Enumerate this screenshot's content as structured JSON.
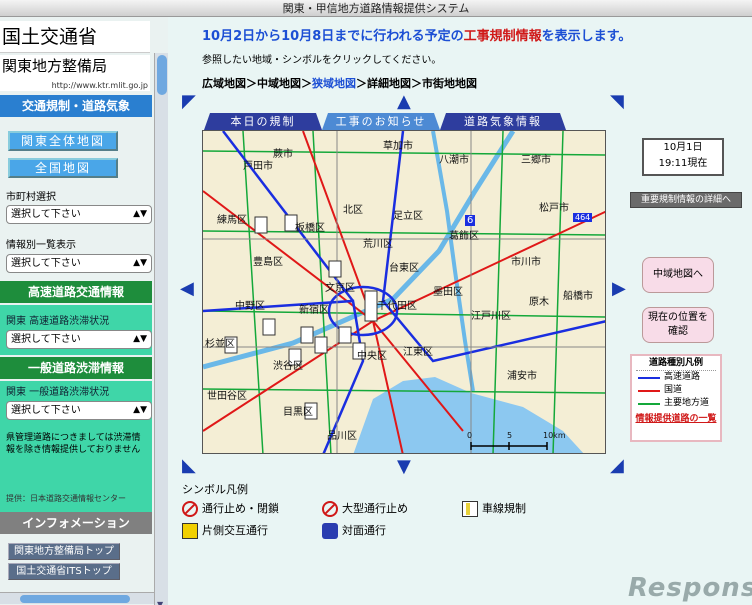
{
  "window": {
    "title": "関東・甲信地方道路情報提供システム"
  },
  "sidebar": {
    "logo_top": "国土交通省",
    "logo_bottom": "関東地方整備局",
    "logo_url": "http://www.ktr.mlit.go.jp",
    "band_traffic": "交通規制・道路気象",
    "btn_kanto": "関東全体地図",
    "btn_all": "全国地図",
    "city_label": "市町村選択",
    "city_select": "選択して下さい",
    "info_label": "情報別一覧表示",
    "info_select": "選択して下さい",
    "band_expressway": "高速道路交通情報",
    "expressway_label": "関東 高速道路渋滞状況",
    "expressway_select": "選択して下さい",
    "band_general": "一般道路渋滞情報",
    "general_label": "関東 一般道路渋滞状況",
    "general_select": "選択して下さい",
    "note": "県管理道路につきましては渋滞情報を除き情報提供しておりません",
    "provider": "提供：日本道路交通情報センター",
    "band_info": "インフォメーション",
    "link_1": "関東地方整備局トップ",
    "link_2": "国土交通省ITSトップ"
  },
  "main": {
    "headline_pre": "10月2日から10月8日までに行われる予定の",
    "headline_highlight": "工事規制情報",
    "headline_post": "を表示します。",
    "subtext": "参照したい地域・シンボルをクリックしてください。",
    "crumbs": [
      "広域地図",
      "中域地図",
      "狭域地図",
      "詳細地図",
      "市街地地図"
    ],
    "crumb_sep": "＞",
    "crumb_current_index": 2,
    "tabs": [
      "本日の規制",
      "工事のお知らせ",
      "道路気象情報"
    ],
    "active_tab": 1,
    "date_line1": "10月1日",
    "date_line2": "19:11現在",
    "detail_button": "重要規制情報の詳細へ",
    "btn_mid_map": "中域地図へ",
    "btn_location": "現在の位置を確認",
    "road_legend": {
      "title": "道路種別凡例",
      "items": [
        {
          "label": "高速道路",
          "color": "#1a2ee0"
        },
        {
          "label": "国道",
          "color": "#e01818"
        },
        {
          "label": "主要地方道",
          "color": "#14a83a"
        }
      ],
      "link": "情報提供道路の一覧"
    },
    "symbol_legend_title": "シンボル凡例",
    "symbols": [
      {
        "label": "通行止め・閉鎖",
        "icon": "no-entry-icon"
      },
      {
        "label": "大型通行止め",
        "icon": "no-trucks-icon"
      },
      {
        "label": "車線規制",
        "icon": "lane-restriction-icon"
      },
      {
        "label": "片側交互通行",
        "icon": "alternating-traffic-icon"
      },
      {
        "label": "対面通行",
        "icon": "two-way-traffic-icon"
      }
    ],
    "map": {
      "areas": [
        "戸田市",
        "蕨市",
        "草加市",
        "八潮市",
        "三郷市",
        "松戸市",
        "練馬区",
        "板橋区",
        "北区",
        "足立区",
        "葛飾区",
        "豊島区",
        "荒川区",
        "市川市",
        "文京区",
        "台東区",
        "墨田区",
        "中野区",
        "新宿区",
        "千代田区",
        "江戸川区",
        "船橋市",
        "杉並区",
        "渋谷区",
        "中央区",
        "江東区",
        "浦安市",
        "世田谷区",
        "目黒区",
        "品川区",
        "原木"
      ],
      "scale": [
        "0",
        "5",
        "10km"
      ],
      "route_numbers": [
        "6",
        "464"
      ]
    },
    "watermark": "Response."
  }
}
